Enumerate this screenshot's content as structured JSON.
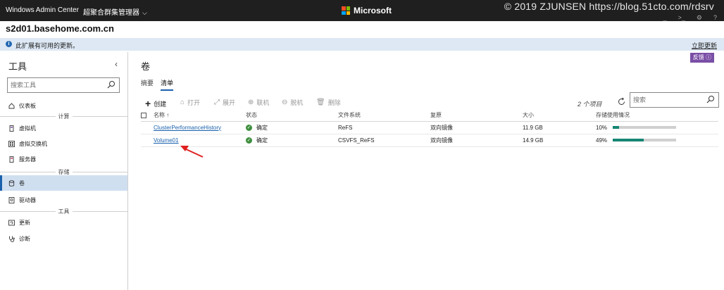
{
  "header": {
    "app_title": "Windows Admin Center",
    "context": "超聚合群集管理器",
    "brand": "Microsoft",
    "watermark": "© 2019 ZJUNSEN https://blog.51cto.com/rdsrv",
    "brand_colors": [
      "#f25022",
      "#7fba00",
      "#00a4ef",
      "#ffb900"
    ]
  },
  "server_name": "s2d01.basehome.com.cn",
  "notice": {
    "message": "此扩展有可用的更新。",
    "action": "立即更新"
  },
  "sidebar": {
    "title": "工具",
    "search_placeholder": "搜索工具",
    "items": [
      {
        "label": "仪表板",
        "icon": "dashboard-icon"
      },
      {
        "section": "计算"
      },
      {
        "label": "虚拟机",
        "icon": "vm-icon"
      },
      {
        "label": "虚拟交换机",
        "icon": "switch-icon"
      },
      {
        "label": "服务器",
        "icon": "server-icon"
      },
      {
        "section": "存储"
      },
      {
        "label": "卷",
        "icon": "volume-icon",
        "active": true
      },
      {
        "label": "驱动器",
        "icon": "drive-icon"
      },
      {
        "section": "工具"
      },
      {
        "label": "更新",
        "icon": "update-icon"
      },
      {
        "label": "诊断",
        "icon": "diagnostics-icon"
      }
    ]
  },
  "main": {
    "title": "卷",
    "feedback": "反馈 ⓘ",
    "tabs": [
      {
        "label": "摘要",
        "active": false
      },
      {
        "label": "清单",
        "active": true
      }
    ],
    "toolbar": {
      "create": "创建",
      "open": "打开",
      "expand": "展开",
      "online": "联机",
      "offline": "脱机",
      "delete": "删除",
      "item_count": "2 个项目",
      "search_placeholder": "搜索"
    },
    "columns": {
      "name": "名称 ↑",
      "status": "状态",
      "filesystem": "文件系统",
      "resiliency": "复原",
      "size": "大小",
      "usage": "存储使用情况"
    },
    "rows": [
      {
        "name": "ClusterPerformanceHistory",
        "status": "确定",
        "filesystem": "ReFS",
        "resiliency": "双向镜像",
        "size": "11.9 GB",
        "usage": "10%",
        "usage_value": 10
      },
      {
        "name": "Volume01",
        "status": "确定",
        "filesystem": "CSVFS_ReFS",
        "resiliency": "双向镜像",
        "size": "14.9 GB",
        "usage": "49%",
        "usage_value": 49
      }
    ]
  }
}
